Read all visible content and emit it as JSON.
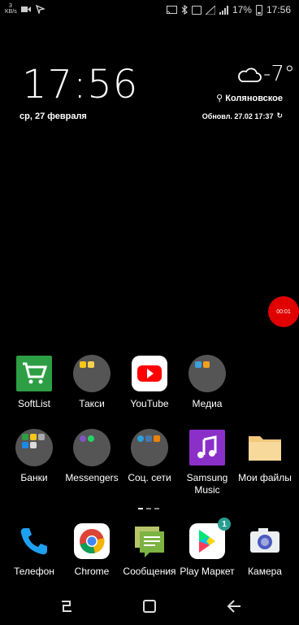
{
  "status_bar": {
    "speed_value": "3",
    "speed_unit": "KB/s",
    "battery": "17%",
    "time": "17:56"
  },
  "clock_widget": {
    "time": "17:56",
    "date": "ср, 27 февраля",
    "temperature": "-7°",
    "location": "Коляновское",
    "updated": "Обновл. 27.02 17:37"
  },
  "recorder": {
    "elapsed": "00:01"
  },
  "apps": [
    {
      "label": "SoftList",
      "icon": "softlist-cart-icon"
    },
    {
      "label": "Такси",
      "icon": "taxi-folder-icon"
    },
    {
      "label": "YouTube",
      "icon": "youtube-icon"
    },
    {
      "label": "Медиа",
      "icon": "media-folder-icon"
    },
    {
      "label": "Банки",
      "icon": "banks-folder-icon"
    },
    {
      "label": "Messengers",
      "icon": "messengers-folder-icon"
    },
    {
      "label": "Соц. сети",
      "icon": "social-folder-icon"
    },
    {
      "label": "Samsung Music",
      "icon": "samsung-music-icon"
    },
    {
      "label": "Мои файлы",
      "icon": "my-files-icon"
    }
  ],
  "dock": [
    {
      "label": "Телефон",
      "icon": "phone-icon"
    },
    {
      "label": "Chrome",
      "icon": "chrome-icon"
    },
    {
      "label": "Сообщения",
      "icon": "messages-icon"
    },
    {
      "label": "Play Маркет",
      "icon": "play-store-icon",
      "badge": "1"
    },
    {
      "label": "Камера",
      "icon": "camera-icon"
    }
  ],
  "colors": {
    "recorder": "#e00000",
    "youtube": "#ff0000",
    "softlist": "#2e9e44",
    "music": "#8b2fc9",
    "folder_bg": "#555555"
  }
}
